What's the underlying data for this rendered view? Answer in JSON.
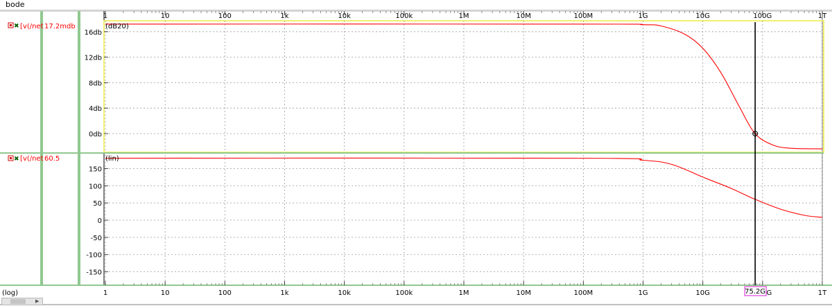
{
  "window": {
    "title": "bode"
  },
  "x_axis_scale_label": "(log)",
  "x_tick_labels": [
    "1",
    "10",
    "100",
    "1k",
    "10k",
    "100k",
    "1M",
    "10M",
    "100M",
    "1G",
    "10G",
    "100G",
    "1T"
  ],
  "cursor": {
    "readout": "75.2G"
  },
  "colors": {
    "trace": "#ff0000",
    "grid": "#9a9a9a",
    "axis_band": "#90c890",
    "selection_box": "#f0f070",
    "cursor_box": "#e040e0",
    "cursor_line": "#000000"
  },
  "icons": [
    "trace-select-box-icon",
    "trace-check-icon"
  ],
  "chart_data": [
    {
      "type": "line",
      "panel": "magnitude",
      "scale_label": "(dB20)",
      "legend_label": "[v(/net",
      "legend_value": "17.2mdb",
      "x_scale": "log",
      "xlim": [
        1,
        1000000000000.0
      ],
      "ylim": [
        -2.5,
        17.5
      ],
      "y_ticks": [
        0,
        4,
        8,
        12,
        16
      ],
      "y_tick_labels": [
        "0db",
        "4db",
        "8db",
        "12db",
        "16db"
      ],
      "grid": true,
      "cursor_x": 75200000000.0,
      "series": [
        {
          "values": [
            [
              1,
              17.2
            ],
            [
              100000000.0,
              17.2
            ],
            [
              1000000000.0,
              17.1
            ],
            [
              2000000000.0,
              16.9
            ],
            [
              5000000000.0,
              15.6
            ],
            [
              10000000000.0,
              13.4
            ],
            [
              20000000000.0,
              9.6
            ],
            [
              40000000000.0,
              4.4
            ],
            [
              75000000000.0,
              0.0
            ],
            [
              150000000000.0,
              -1.8
            ],
            [
              300000000000.0,
              -2.3
            ],
            [
              1000000000000.0,
              -2.4
            ]
          ]
        }
      ]
    },
    {
      "type": "line",
      "panel": "phase",
      "scale_label": "(lin)",
      "legend_label": "[v(/net",
      "legend_value": "60.5",
      "x_scale": "log",
      "xlim": [
        1,
        1000000000000.0
      ],
      "ylim": [
        -185,
        185
      ],
      "y_ticks": [
        -150,
        -100,
        -50,
        0,
        50,
        100,
        150
      ],
      "y_tick_labels": [
        "-150",
        "-100",
        "-50",
        "0",
        "50",
        "100",
        "150"
      ],
      "grid": true,
      "cursor_x": 75200000000.0,
      "series": [
        {
          "values": [
            [
              1,
              180
            ],
            [
              100000000.0,
              180
            ],
            [
              1000000000.0,
              174
            ],
            [
              3000000000.0,
              162
            ],
            [
              10000000000.0,
              125
            ],
            [
              30000000000.0,
              92
            ],
            [
              75000000000.0,
              60.5
            ],
            [
              200000000000.0,
              32
            ],
            [
              500000000000.0,
              14
            ],
            [
              1000000000000.0,
              8
            ]
          ]
        }
      ]
    }
  ]
}
